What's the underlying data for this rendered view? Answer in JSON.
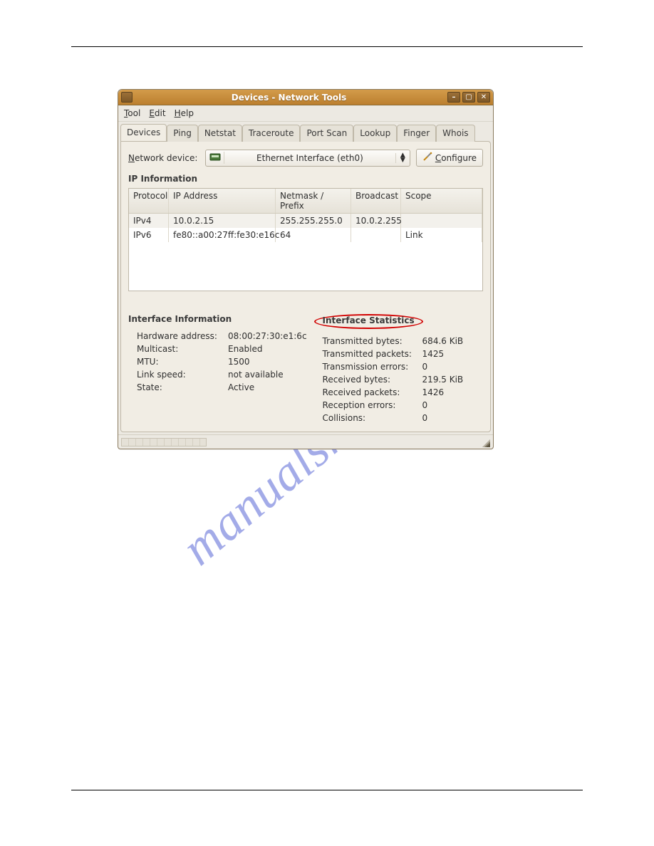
{
  "watermark": "manualshive.com",
  "window": {
    "title": "Devices - Network Tools",
    "menu": {
      "tool": "Tool",
      "edit": "Edit",
      "help": "Help"
    },
    "tabs": [
      {
        "label": "Devices"
      },
      {
        "label": "Ping"
      },
      {
        "label": "Netstat"
      },
      {
        "label": "Traceroute"
      },
      {
        "label": "Port Scan"
      },
      {
        "label": "Lookup"
      },
      {
        "label": "Finger"
      },
      {
        "label": "Whois"
      }
    ],
    "netdev_label": "Network device:",
    "netdev_value": "Ethernet Interface (eth0)",
    "configure_label": "Configure",
    "ip_section": "IP Information",
    "ip_headers": {
      "protocol": "Protocol",
      "ip": "IP Address",
      "mask": "Netmask / Prefix",
      "bcast": "Broadcast",
      "scope": "Scope"
    },
    "ip_rows": [
      {
        "protocol": "IPv4",
        "ip": "10.0.2.15",
        "mask": "255.255.255.0",
        "bcast": "10.0.2.255",
        "scope": ""
      },
      {
        "protocol": "IPv6",
        "ip": "fe80::a00:27ff:fe30:e16c",
        "mask": "64",
        "bcast": "",
        "scope": "Link"
      }
    ],
    "iface_info": {
      "heading": "Interface Information",
      "rows": [
        {
          "k": "Hardware address:",
          "v": "08:00:27:30:e1:6c"
        },
        {
          "k": "Multicast:",
          "v": "Enabled"
        },
        {
          "k": "MTU:",
          "v": "1500"
        },
        {
          "k": "Link speed:",
          "v": "not available"
        },
        {
          "k": "State:",
          "v": "Active"
        }
      ]
    },
    "iface_stats": {
      "heading": "Interface Statistics",
      "rows": [
        {
          "k": "Transmitted bytes:",
          "v": "684.6 KiB"
        },
        {
          "k": "Transmitted packets:",
          "v": "1425"
        },
        {
          "k": "Transmission errors:",
          "v": "0"
        },
        {
          "k": "Received bytes:",
          "v": "219.5 KiB"
        },
        {
          "k": "Received packets:",
          "v": "1426"
        },
        {
          "k": "Reception errors:",
          "v": "0"
        },
        {
          "k": "Collisions:",
          "v": "0"
        }
      ]
    }
  }
}
